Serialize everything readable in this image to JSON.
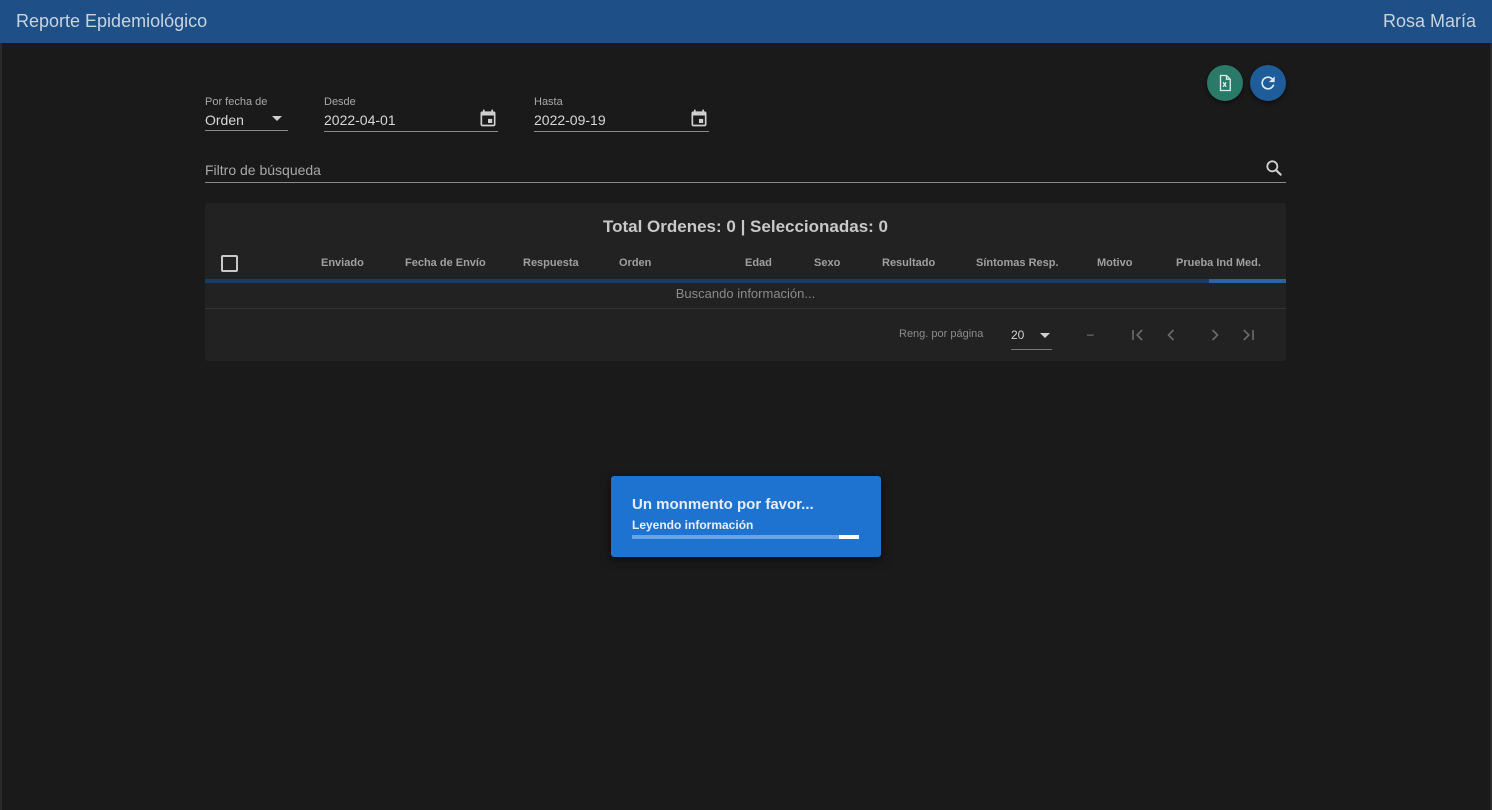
{
  "header": {
    "title": "Reporte Epidemiológico",
    "user": "Rosa María"
  },
  "actions": {
    "export_icon": "excel-icon",
    "refresh_icon": "refresh-icon"
  },
  "filters": {
    "order_by": {
      "label": "Por fecha de",
      "value": "Orden"
    },
    "from": {
      "label": "Desde",
      "value": "2022-04-01"
    },
    "to": {
      "label": "Hasta",
      "value": "2022-09-19"
    },
    "search": {
      "placeholder": "Filtro de búsqueda",
      "value": ""
    }
  },
  "table": {
    "title": "Total Ordenes: 0 | Seleccionadas: 0",
    "columns": [
      "Enviado",
      "Fecha de Envío",
      "Respuesta",
      "Orden",
      "Edad",
      "Sexo",
      "Resultado",
      "Síntomas Resp.",
      "Motivo",
      "Prueba Ind Med."
    ],
    "loading_text": "Buscando información...",
    "rows": [],
    "pagination": {
      "rows_per_page_label": "Reng. por página",
      "rows_per_page": "20",
      "range": "–"
    }
  },
  "loading_dialog": {
    "title": "Un monmento por favor...",
    "subtitle": "Leyendo información",
    "progress": 0.95
  },
  "colors": {
    "topbar": "#1e5087",
    "background": "#1a1a1b",
    "dialog": "#1e73d1",
    "excel_button": "#2a7a6a",
    "refresh_button": "#1e5c9a"
  }
}
